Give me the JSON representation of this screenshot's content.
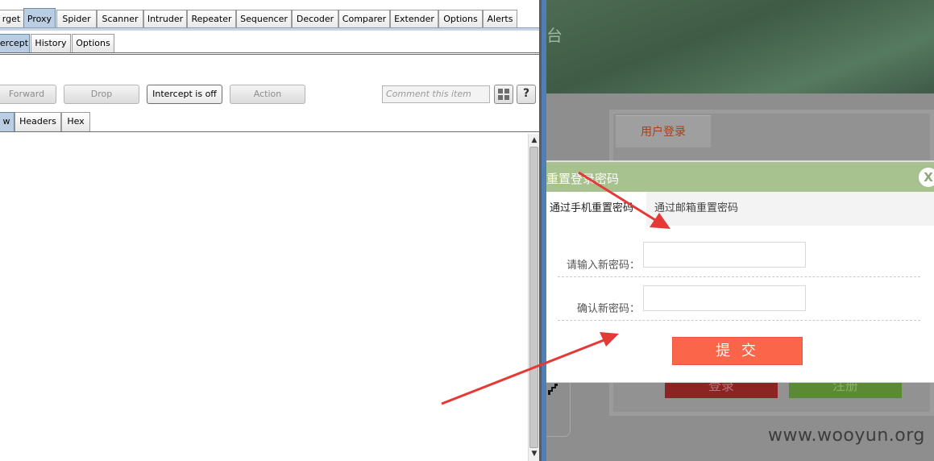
{
  "burp": {
    "main_tabs": [
      "rget",
      "Proxy",
      "Spider",
      "Scanner",
      "Intruder",
      "Repeater",
      "Sequencer",
      "Decoder",
      "Comparer",
      "Extender",
      "Options",
      "Alerts"
    ],
    "active_main_tab": "Proxy",
    "sub_tabs": [
      "ercept",
      "History",
      "Options"
    ],
    "active_sub_tab": "ercept",
    "toolbar": {
      "forward": "Forward",
      "drop": "Drop",
      "intercept": "Intercept is off",
      "action": "Action",
      "comment_placeholder": "Comment this item",
      "help": "?"
    },
    "message_tabs": [
      "w",
      "Headers",
      "Hex"
    ],
    "active_message_tab": "w"
  },
  "web": {
    "hero_fragment": "台",
    "login_tab": "用户登录",
    "login_button": "登录",
    "register_button": "注册",
    "watermark": "www.wooyun.org",
    "modal": {
      "title": "重置登录密码",
      "close": "X",
      "tab_phone": "通过手机重置密码",
      "tab_email": "通过邮箱重置密码",
      "new_password_label": "请输入新密码：",
      "confirm_password_label": "确认新密码：",
      "submit": "提 交"
    }
  },
  "colors": {
    "burp_active_tab": "#b9cde3",
    "modal_header": "#a7c18f",
    "submit_button": "#fb6549",
    "login_tab_text": "#a8401a",
    "annotation_arrow": "#e53935"
  }
}
